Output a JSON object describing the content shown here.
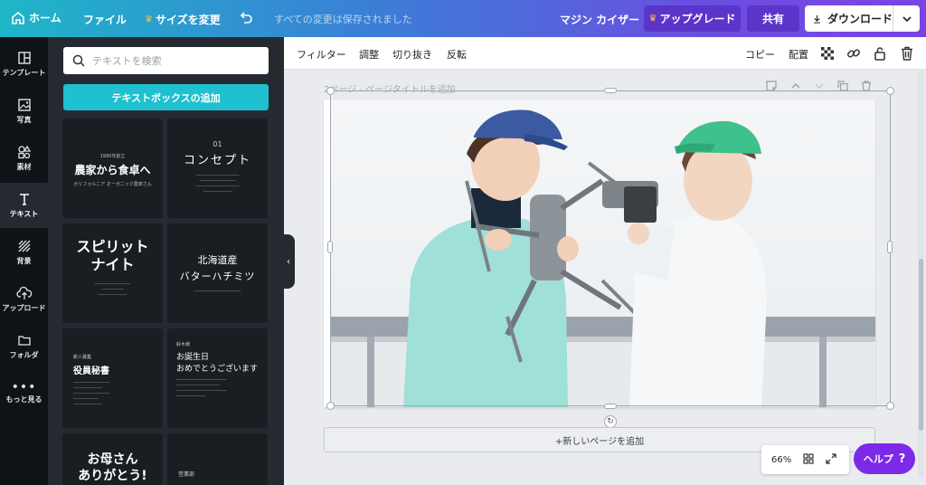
{
  "topbar": {
    "home": "ホーム",
    "file": "ファイル",
    "resize": "サイズを変更",
    "saved_status": "すべての変更は保存されました",
    "design_title": "マジン カイザー",
    "upgrade": "アップグレード",
    "share": "共有",
    "download": "ダウンロード"
  },
  "rail": {
    "items": [
      {
        "label": "テンプレート",
        "icon": "template-icon"
      },
      {
        "label": "写真",
        "icon": "photo-icon"
      },
      {
        "label": "素材",
        "icon": "elements-icon"
      },
      {
        "label": "テキスト",
        "icon": "text-icon"
      },
      {
        "label": "背景",
        "icon": "background-icon"
      },
      {
        "label": "アップロード",
        "icon": "upload-icon"
      },
      {
        "label": "フォルダ",
        "icon": "folder-icon"
      },
      {
        "label": "もっと見る",
        "icon": "more-icon"
      }
    ]
  },
  "panel": {
    "search_placeholder": "テキストを検索",
    "add_textbox": "テキストボックスの追加",
    "templates": [
      {
        "line1": "1990年創立",
        "line2": "農家から食卓へ",
        "line3": "ガリフォルニア オーガニック農家さん"
      },
      {
        "line1": "01",
        "line2": "コンセプト"
      },
      {
        "line2": "スピリット",
        "line3": "ナイト"
      },
      {
        "line1": "北海道産",
        "line2": "バターハチミツ"
      },
      {
        "line1": "新人募集",
        "line2": "役員秘書"
      },
      {
        "line1": "鈴木様",
        "line2": "お誕生日",
        "line3": "おめでとうございます"
      },
      {
        "line2": "お母さん",
        "line3": "ありがとう!"
      },
      {
        "line1": "営業部"
      }
    ]
  },
  "toolbar": {
    "filter": "フィルター",
    "adjust": "調整",
    "crop": "切り抜き",
    "flip": "反転",
    "copy": "コピー",
    "position": "配置"
  },
  "canvas": {
    "page_label": "2ページ - ページタイトルを追加",
    "add_page": "+新しいページを追加"
  },
  "footer": {
    "zoom": "66%",
    "help": "ヘルプ",
    "help_icon": "?"
  },
  "colors": {
    "accent_teal": "#1fc0d0",
    "accent_purple": "#7d2ae8",
    "panel_bg": "#252a31"
  }
}
